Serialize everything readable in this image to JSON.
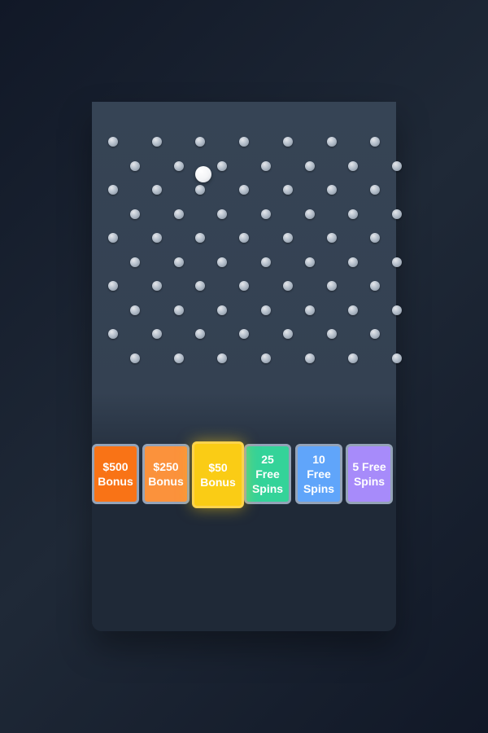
{
  "game": {
    "board_color": "#364455",
    "peg_color": "#b6c0cc",
    "ball_color": "#ffffff"
  },
  "slots": [
    {
      "label": "$500 Bonus",
      "color": "#f97316",
      "highlighted": false
    },
    {
      "label": "$250 Bonus",
      "color": "#fb923c",
      "highlighted": false
    },
    {
      "label": "$50 Bonus",
      "color": "#facc15",
      "highlighted": true
    },
    {
      "label": "25 Free Spins",
      "color": "#34d399",
      "highlighted": false
    },
    {
      "label": "10 Free Spins",
      "color": "#60a5fa",
      "highlighted": false
    },
    {
      "label": "5 Free Spins",
      "color": "#a78bfa",
      "highlighted": false
    }
  ]
}
